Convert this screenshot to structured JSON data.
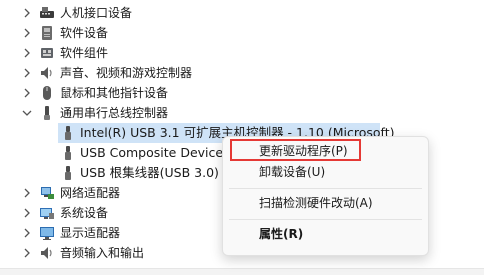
{
  "tree": {
    "categories_top": [
      {
        "label": "人机接口设备",
        "icon": "hid-icon"
      },
      {
        "label": "软件设备",
        "icon": "software-device-icon"
      },
      {
        "label": "软件组件",
        "icon": "software-component-icon"
      },
      {
        "label": "声音、视频和游戏控制器",
        "icon": "speaker-icon"
      },
      {
        "label": "鼠标和其他指针设备",
        "icon": "mouse-icon"
      }
    ],
    "expanded_category": {
      "label": "通用串行总线控制器",
      "icon": "usb-controller-icon"
    },
    "usb_children": [
      {
        "label": "Intel(R) USB 3.1 可扩展主机控制器 - 1.10 (Microsoft)",
        "icon": "usb-plug-icon",
        "selected": true
      },
      {
        "label": "USB Composite Device",
        "icon": "usb-plug-icon"
      },
      {
        "label": "USB 根集线器(USB 3.0)",
        "icon": "usb-plug-icon"
      }
    ],
    "categories_bottom": [
      {
        "label": "网络适配器",
        "icon": "network-adapter-icon"
      },
      {
        "label": "系统设备",
        "icon": "system-device-icon"
      },
      {
        "label": "显示适配器",
        "icon": "display-adapter-icon"
      },
      {
        "label": "音频输入和输出",
        "icon": "audio-io-icon"
      }
    ]
  },
  "context_menu": {
    "items": [
      {
        "label": "更新驱动程序(P)",
        "highlighted": true
      },
      {
        "label": "卸载设备(U)"
      },
      {
        "label": "扫描检测硬件改动(A)"
      },
      {
        "label": "属性(R)",
        "bold": true
      }
    ]
  },
  "colors": {
    "selection": "#cfe3f7",
    "highlight_box": "#e53935",
    "menu_bg": "#f9f9f9"
  }
}
